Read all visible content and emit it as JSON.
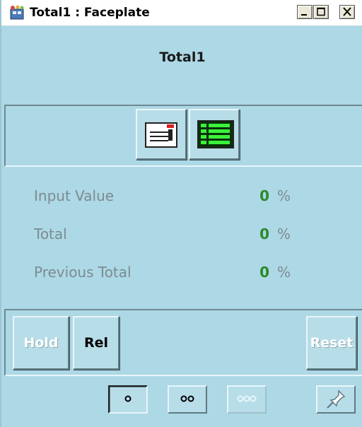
{
  "window": {
    "title": "Total1 : Faceplate",
    "icon": "faceplate-app-icon",
    "controls": [
      "minimize-icon",
      "maximize-icon",
      "close-icon"
    ]
  },
  "header": {
    "title": "Total1"
  },
  "toolbar": {
    "buttons": [
      {
        "icon": "message-card-icon"
      },
      {
        "icon": "data-grid-icon"
      }
    ]
  },
  "values": [
    {
      "label": "Input Value",
      "value": "0",
      "unit": "%"
    },
    {
      "label": "Total",
      "value": "0",
      "unit": "%"
    },
    {
      "label": "Previous Total",
      "value": "0",
      "unit": "%"
    }
  ],
  "actions": {
    "hold_label": "Hold",
    "rel_label": "Rel",
    "reset_label": "Reset"
  },
  "nav": {
    "buttons": [
      {
        "icon": "one-dot-icon",
        "state": "selected"
      },
      {
        "icon": "two-dots-icon",
        "state": "normal"
      },
      {
        "icon": "three-dots-icon",
        "state": "disabled"
      },
      {
        "icon": "pin-icon",
        "state": "normal"
      }
    ]
  },
  "colors": {
    "background": "#add8e6",
    "value_green": "#2a8a2a",
    "label_gray": "#7c8c90"
  }
}
